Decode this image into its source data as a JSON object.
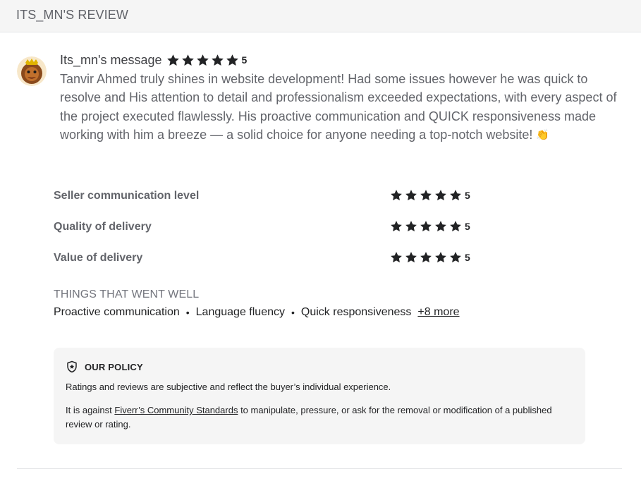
{
  "header": {
    "title": "ITS_MN'S REVIEW"
  },
  "review": {
    "name": "Its_mn's message",
    "rating": "5",
    "rating_value": 5,
    "text": "Tanvir Ahmed truly shines in website development! Had some issues however he was quick to resolve and His attention to detail and professionalism exceeded expectations, with every aspect of the project executed flawlessly. His proactive communication and QUICK responsiveness made working with him a breeze — a solid choice for anyone needing a top-notch website!",
    "emoji": "👏"
  },
  "criteria": [
    {
      "label": "Seller communication level",
      "rating": "5",
      "rating_value": 5
    },
    {
      "label": "Quality of delivery",
      "rating": "5",
      "rating_value": 5
    },
    {
      "label": "Value of delivery",
      "rating": "5",
      "rating_value": 5
    }
  ],
  "went_well": {
    "title": "THINGS THAT WENT WELL",
    "items": [
      "Proactive communication",
      "Language fluency",
      "Quick responsiveness"
    ],
    "separator": "•",
    "more": "+8 more"
  },
  "policy": {
    "title": "OUR POLICY",
    "p1": "Ratings and reviews are subjective and reflect the buyer’s individual experience.",
    "p2_before": "It is against ",
    "p2_link": "Fiverr’s Community Standards",
    "p2_after": " to manipulate, pressure, or ask for the removal or modification of a published review or rating."
  },
  "colors": {
    "star": "#222325",
    "header_bg": "#f5f5f5",
    "policy_bg": "#f5f5f5",
    "muted_text": "#62646a"
  },
  "icons": {
    "star": "star-icon",
    "policy": "shield-star-icon",
    "avatar": "lion-avatar"
  }
}
